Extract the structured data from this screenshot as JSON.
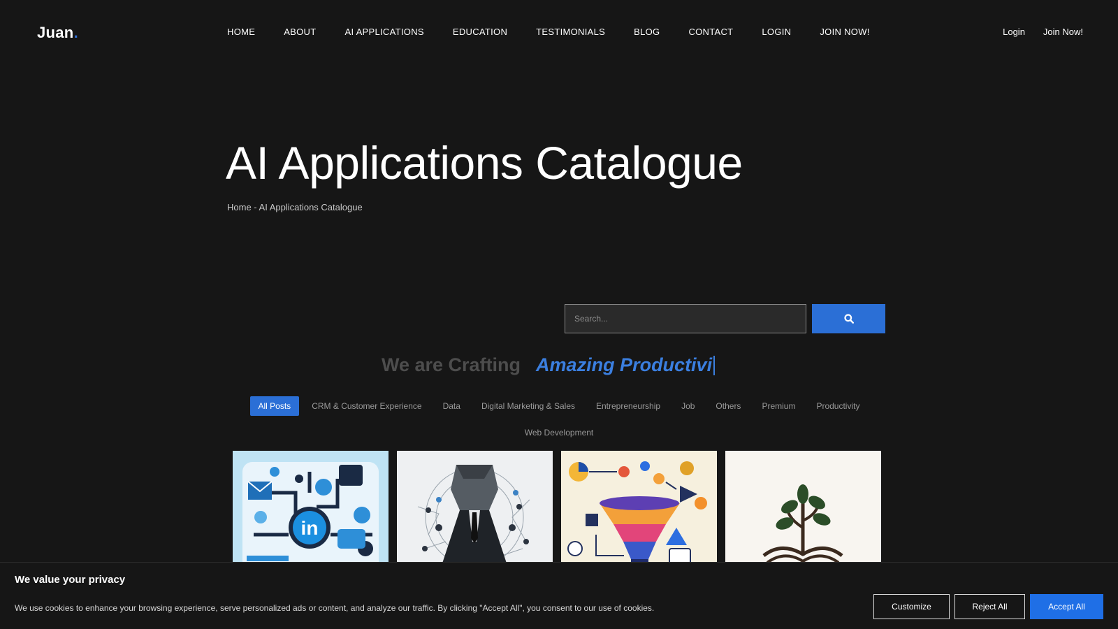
{
  "brand": {
    "name": "Juan",
    "dot": "."
  },
  "nav": {
    "items": [
      {
        "label": "HOME"
      },
      {
        "label": "ABOUT"
      },
      {
        "label": "AI APPLICATIONS"
      },
      {
        "label": "EDUCATION"
      },
      {
        "label": "TESTIMONIALS"
      },
      {
        "label": "BLOG"
      },
      {
        "label": "CONTACT"
      },
      {
        "label": "LOGIN"
      },
      {
        "label": "JOIN NOW!"
      }
    ]
  },
  "auth": {
    "login": "Login",
    "join": "Join Now!"
  },
  "hero": {
    "title": "AI Applications Catalogue",
    "breadcrumb": {
      "home": "Home",
      "separator": " - ",
      "current": "AI Applications Catalogue"
    }
  },
  "search": {
    "placeholder": "Search...",
    "button_icon": "search-icon"
  },
  "tagline": {
    "static": "We are Crafting",
    "dynamic": "Amazing Productivi"
  },
  "filters": [
    {
      "label": "All Posts",
      "active": true
    },
    {
      "label": "CRM & Customer Experience"
    },
    {
      "label": "Data"
    },
    {
      "label": "Digital Marketing & Sales"
    },
    {
      "label": "Entrepreneurship"
    },
    {
      "label": "Job"
    },
    {
      "label": "Others"
    },
    {
      "label": "Premium"
    },
    {
      "label": "Productivity"
    },
    {
      "label": "Web Development"
    }
  ],
  "cards": [
    {
      "image": "linkedin-network-illustration"
    },
    {
      "image": "polygon-businessman-illustration"
    },
    {
      "image": "marketing-funnel-illustration"
    },
    {
      "image": "book-tree-logo"
    }
  ],
  "cookie": {
    "title": "We value your privacy",
    "text": "We use cookies to enhance your browsing experience, serve personalized ads or content, and analyze our traffic. By clicking \"Accept All\", you consent to our use of cookies.",
    "customize": "Customize",
    "reject": "Reject All",
    "accept": "Accept All"
  },
  "colors": {
    "accent": "#2b6fd6",
    "background": "#161616"
  }
}
